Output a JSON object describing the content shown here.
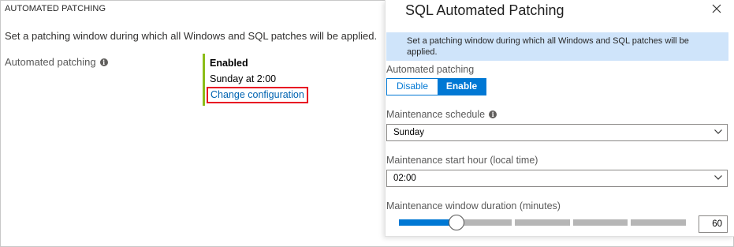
{
  "left_pane": {
    "section_title": "AUTOMATED PATCHING",
    "description": "Set a patching window during which all Windows and SQL patches will be applied.",
    "field_label": "Automated patching",
    "status": "Enabled",
    "schedule": "Sunday at 2:00",
    "change_link": "Change configuration"
  },
  "blade": {
    "title": "SQL Automated Patching",
    "banner": "Set a patching window during which all Windows and SQL patches will be applied.",
    "automated_patching_label": "Automated patching",
    "toggle": {
      "disable_label": "Disable",
      "enable_label": "Enable",
      "selected": "Enable"
    },
    "maintenance_schedule_label": "Maintenance schedule",
    "maintenance_schedule_value": "Sunday",
    "start_hour_label": "Maintenance start hour (local time)",
    "start_hour_value": "02:00",
    "duration_label": "Maintenance window duration (minutes)",
    "duration_value": "60",
    "duration_fraction": 0.2
  },
  "colors": {
    "accent": "#0078d4",
    "status_bar": "#8cbd18",
    "highlight_box": "#e81123",
    "banner_bg": "#cfe4fa"
  },
  "icons": [
    "info-icon",
    "close-icon",
    "chevron-down-icon"
  ]
}
